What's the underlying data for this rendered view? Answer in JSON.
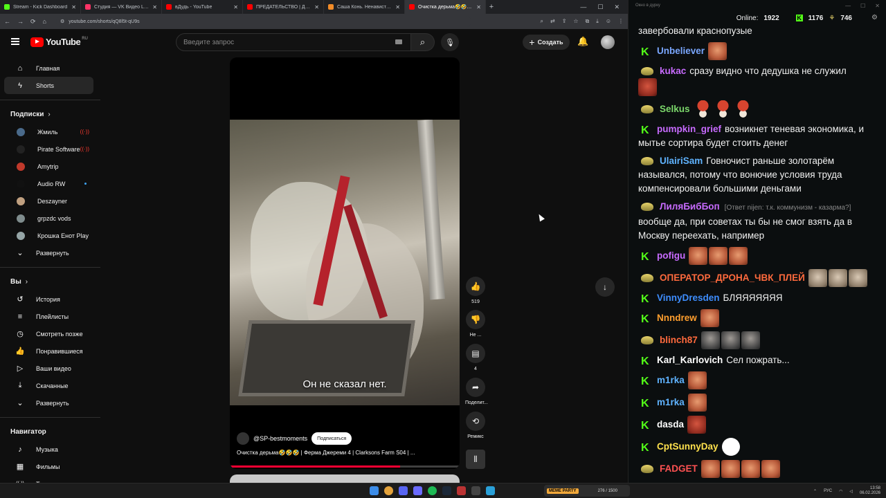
{
  "browser": {
    "tabs": [
      {
        "title": "Stream - Kick Dashboard",
        "color": "#53fc18",
        "active": false
      },
      {
        "title": "Студия — VK Видео Live",
        "color": "#ff3366",
        "active": false
      },
      {
        "title": "вДудь - YouTube",
        "color": "#ff0000",
        "active": false
      },
      {
        "title": "ПРЕДАТЕЛЬСТВО | Документа...",
        "color": "#ff0000",
        "active": false
      },
      {
        "title": "Саша Конь. Ненависть к Стас...",
        "color": "#f28c28",
        "active": false
      },
      {
        "title": "Очистка дерьма🤣🤣🤣 | Ф",
        "color": "#ff0000",
        "active": true
      }
    ],
    "url": "youtube.com/shorts/qQ8l5t-qU9s"
  },
  "header": {
    "logo_text": "YouTube",
    "logo_region": "RU",
    "search_placeholder": "Введите запрос",
    "create_label": "Создать"
  },
  "sidebar": {
    "main": [
      {
        "label": "Главная",
        "icon": "home-icon",
        "glyph": "⌂",
        "active": false
      },
      {
        "label": "Shorts",
        "icon": "shorts-icon",
        "glyph": "ϟ",
        "active": true
      }
    ],
    "subs_heading": "Подписки",
    "subs": [
      {
        "label": "Жмиль",
        "color": "#4a6a8a",
        "live": true
      },
      {
        "label": "Pirate Software",
        "color": "#222222",
        "live": true
      },
      {
        "label": "Amytrip",
        "color": "#c0392b",
        "live": false
      },
      {
        "label": "Audio RW",
        "color": "#111111",
        "live": false,
        "new": true
      },
      {
        "label": "Deszayner",
        "color": "#c0a080",
        "live": false
      },
      {
        "label": "grpzdc vods",
        "color": "#7f8c8d",
        "live": false
      },
      {
        "label": "Крошка Енот Play",
        "color": "#95a5a6",
        "live": false
      }
    ],
    "subs_expand": "Развернуть",
    "you_heading": "Вы",
    "you": [
      {
        "label": "История",
        "glyph": "↺",
        "icon": "history-icon"
      },
      {
        "label": "Плейлисты",
        "glyph": "≡",
        "icon": "playlists-icon"
      },
      {
        "label": "Смотреть позже",
        "glyph": "◷",
        "icon": "watch-later-icon"
      },
      {
        "label": "Понравившиеся",
        "glyph": "👍",
        "icon": "liked-icon"
      },
      {
        "label": "Ваши видео",
        "glyph": "▷",
        "icon": "your-videos-icon"
      },
      {
        "label": "Скачанные",
        "glyph": "⤓",
        "icon": "downloads-icon"
      }
    ],
    "you_expand": "Развернуть",
    "nav_heading": "Навигатор",
    "nav": [
      {
        "label": "Музыка",
        "glyph": "♪",
        "icon": "music-icon"
      },
      {
        "label": "Фильмы",
        "glyph": "▦",
        "icon": "movies-icon"
      },
      {
        "label": "Трансляции",
        "glyph": "((·))",
        "icon": "live-icon"
      }
    ]
  },
  "short": {
    "subtitle": "Он не сказал нет.",
    "channel": "@SP-bestmoments",
    "subscribe_label": "Подписаться",
    "title": "Очистка дерьма🤣🤣🤣 | Ферма Джереми 4 | Clarksons Farm S04 | ...",
    "progress": 0.74,
    "actions": {
      "likes": "519",
      "dislike": "Не ...",
      "comments": "4",
      "share": "Поделит...",
      "remix": "Ремикс"
    }
  },
  "chat": {
    "window_title": "Окно в дурку",
    "online_label": "Online:",
    "online": "1922",
    "kick_count": "1176",
    "other_count": "746",
    "messages": [
      {
        "badge": "",
        "user": "",
        "color": "#ffffff",
        "text": "завербовали краснопузые",
        "emotes": []
      },
      {
        "badge": "k",
        "user": "Unbeliever",
        "color": "#7aa7ff",
        "text": "",
        "emotes": [
          "e-face"
        ]
      },
      {
        "badge": "c",
        "user": "kukac",
        "color": "#c86bff",
        "text": "сразу видно что дедушка не служил",
        "emotes": [
          "e-red"
        ]
      },
      {
        "badge": "c",
        "user": "Selkus",
        "color": "#7cd86b",
        "text": "",
        "emotes": [
          "e-mush",
          "e-mush",
          "e-mush"
        ]
      },
      {
        "badge": "k",
        "user": "pumpkin_grief",
        "color": "#c86bff",
        "text": "возникнет теневая экономика, и мытье сортира будет стоить денег",
        "emotes": []
      },
      {
        "badge": "c",
        "user": "UlairiSam",
        "color": "#5fb3ff",
        "text": "Говночист раньше золотарём назывался, потому что вонючие условия труда компенсировали большими деньгами",
        "emotes": []
      },
      {
        "badge": "c",
        "user": "ЛиляБибБоп",
        "color": "#c86bff",
        "reply": "[Ответ nijen: т.к. коммунизм - казарма?]",
        "text": "вообще да, при советах ты бы не смог взять да в Москву переехать, например",
        "emotes": []
      },
      {
        "badge": "k",
        "user": "pofigu",
        "color": "#c86bff",
        "text": "",
        "emotes": [
          "e-face",
          "e-face",
          "e-face"
        ]
      },
      {
        "badge": "c",
        "user": "ОПЕРАТОР_ДРОНА_ЧВК_ПЛЕЙ",
        "color": "#ff6a3d",
        "text": "",
        "emotes": [
          "e-pale",
          "e-pale",
          "e-pale"
        ]
      },
      {
        "badge": "k",
        "user": "VinnyDresden",
        "color": "#3e8eff",
        "text": "БЛЯЯЯЯЯЯЯ",
        "emotes": []
      },
      {
        "badge": "k",
        "user": "Nnndrew",
        "color": "#ff9f2e",
        "text": "",
        "emotes": [
          "e-face"
        ]
      },
      {
        "badge": "c",
        "user": "blinch87",
        "color": "#ff6a3d",
        "text": "",
        "emotes": [
          "e-dark",
          "e-dark",
          "e-dark"
        ]
      },
      {
        "badge": "k",
        "user": "Karl_Karlovich",
        "color": "#ffffff",
        "text": "Сел пожрать...",
        "emotes": []
      },
      {
        "badge": "k",
        "user": "m1rka",
        "color": "#5fb3ff",
        "text": "",
        "emotes": [
          "e-face"
        ]
      },
      {
        "badge": "k",
        "user": "m1rka",
        "color": "#5fb3ff",
        "text": "",
        "emotes": [
          "e-face"
        ]
      },
      {
        "badge": "k",
        "user": "dasda",
        "color": "#ffffff",
        "text": "",
        "emotes": [
          "e-red"
        ]
      },
      {
        "badge": "k",
        "user": "CptSunnyDay",
        "color": "#ffe14d",
        "text": "",
        "emotes": [
          "e-troll"
        ]
      },
      {
        "badge": "c",
        "user": "FADGET",
        "color": "#ff5252",
        "text": "",
        "emotes": [
          "e-face",
          "e-face",
          "e-face",
          "e-face"
        ]
      }
    ]
  },
  "taskbar": {
    "widget_tag": "MEME PARTY",
    "widget_count": "276 / 1500",
    "lang": "РУС",
    "time": "13:58",
    "date": "06.02.2026"
  }
}
